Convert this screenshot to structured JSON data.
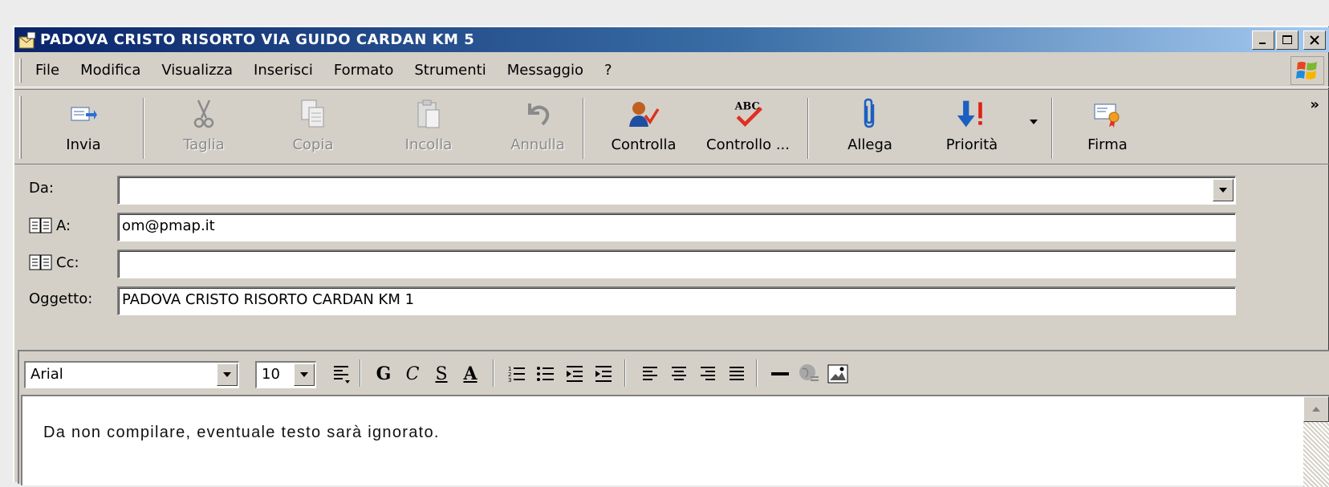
{
  "window": {
    "title": "PADOVA CRISTO RISORTO VIA GUIDO CARDAN KM 5",
    "controls": {
      "minimize": "_",
      "maximize": "□",
      "close": "✕"
    }
  },
  "menu": [
    "File",
    "Modifica",
    "Visualizza",
    "Inserisci",
    "Formato",
    "Strumenti",
    "Messaggio",
    "?"
  ],
  "toolbar": {
    "send": "Invia",
    "cut": "Taglia",
    "copy": "Copia",
    "paste": "Incolla",
    "undo": "Annulla",
    "check": "Controlla",
    "spell": "Controllo ...",
    "attach": "Allega",
    "priority": "Priorità",
    "sign": "Firma",
    "more": "»"
  },
  "fields": {
    "from_label": "Da:",
    "from_value": "",
    "to_label": "A:",
    "to_value": "om@pmap.it",
    "cc_label": "Cc:",
    "cc_value": "",
    "subject_label": "Oggetto:",
    "subject_value": "PADOVA CRISTO RISORTO CARDAN KM 1"
  },
  "format": {
    "font": "Arial",
    "size": "10",
    "bold": "G",
    "italic": "C",
    "underline": "S",
    "font_color": "A"
  },
  "body": {
    "text": "Da non compilare, eventuale testo sarà ignorato."
  },
  "colors": {
    "title_start": "#0a246a",
    "title_end": "#a6caf0",
    "chrome": "#d4d0c8"
  }
}
